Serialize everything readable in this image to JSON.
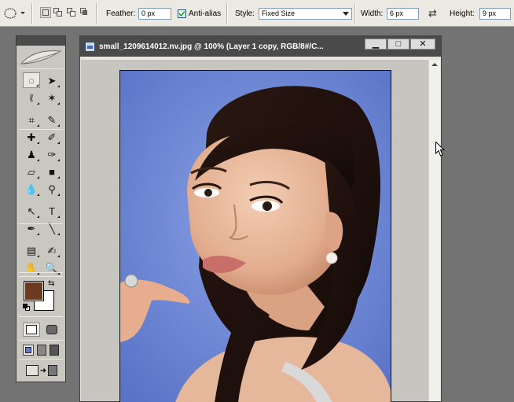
{
  "options_bar": {
    "feather_label": "Feather:",
    "feather_value": "0 px",
    "antialias_label": "Anti-alias",
    "antialias_checked": true,
    "style_label": "Style:",
    "style_value": "Fixed Size",
    "width_label": "Width:",
    "width_value": "6 px",
    "height_label": "Height:",
    "height_value": "9 px",
    "swap_glyph": "⇄"
  },
  "document": {
    "title": "small_1209614012.nv.jpg @ 100% (Layer 1 copy, RGB/8#/C...",
    "minimize": "▁",
    "maximize": "□",
    "close": "✕"
  },
  "toolbox": {
    "tools": [
      {
        "name": "rect-marquee-tool",
        "glyph": "◌"
      },
      {
        "name": "move-tool",
        "glyph": "➤"
      },
      {
        "name": "lasso-tool",
        "glyph": "ℓ"
      },
      {
        "name": "magic-wand-tool",
        "glyph": "✶"
      },
      {
        "name": "crop-tool",
        "glyph": "⌗"
      },
      {
        "name": "slice-tool",
        "glyph": "✎"
      },
      {
        "name": "healing-brush-tool",
        "glyph": "✚"
      },
      {
        "name": "brush-tool",
        "glyph": "✐"
      },
      {
        "name": "clone-stamp-tool",
        "glyph": "♟"
      },
      {
        "name": "history-brush-tool",
        "glyph": "✑"
      },
      {
        "name": "eraser-tool",
        "glyph": "▱"
      },
      {
        "name": "gradient-tool",
        "glyph": "■"
      },
      {
        "name": "blur-tool",
        "glyph": "💧"
      },
      {
        "name": "dodge-tool",
        "glyph": "⚲"
      },
      {
        "name": "path-selection-tool",
        "glyph": "↖"
      },
      {
        "name": "type-tool",
        "glyph": "T"
      },
      {
        "name": "pen-tool",
        "glyph": "✒"
      },
      {
        "name": "line-tool",
        "glyph": "╲"
      },
      {
        "name": "notes-tool",
        "glyph": "▤"
      },
      {
        "name": "eyedropper-tool",
        "glyph": "✍"
      },
      {
        "name": "hand-tool",
        "glyph": "✋"
      },
      {
        "name": "zoom-tool",
        "glyph": "🔍"
      }
    ],
    "foreground_color": "#6b3a1f",
    "background_color": "#ffffff"
  }
}
